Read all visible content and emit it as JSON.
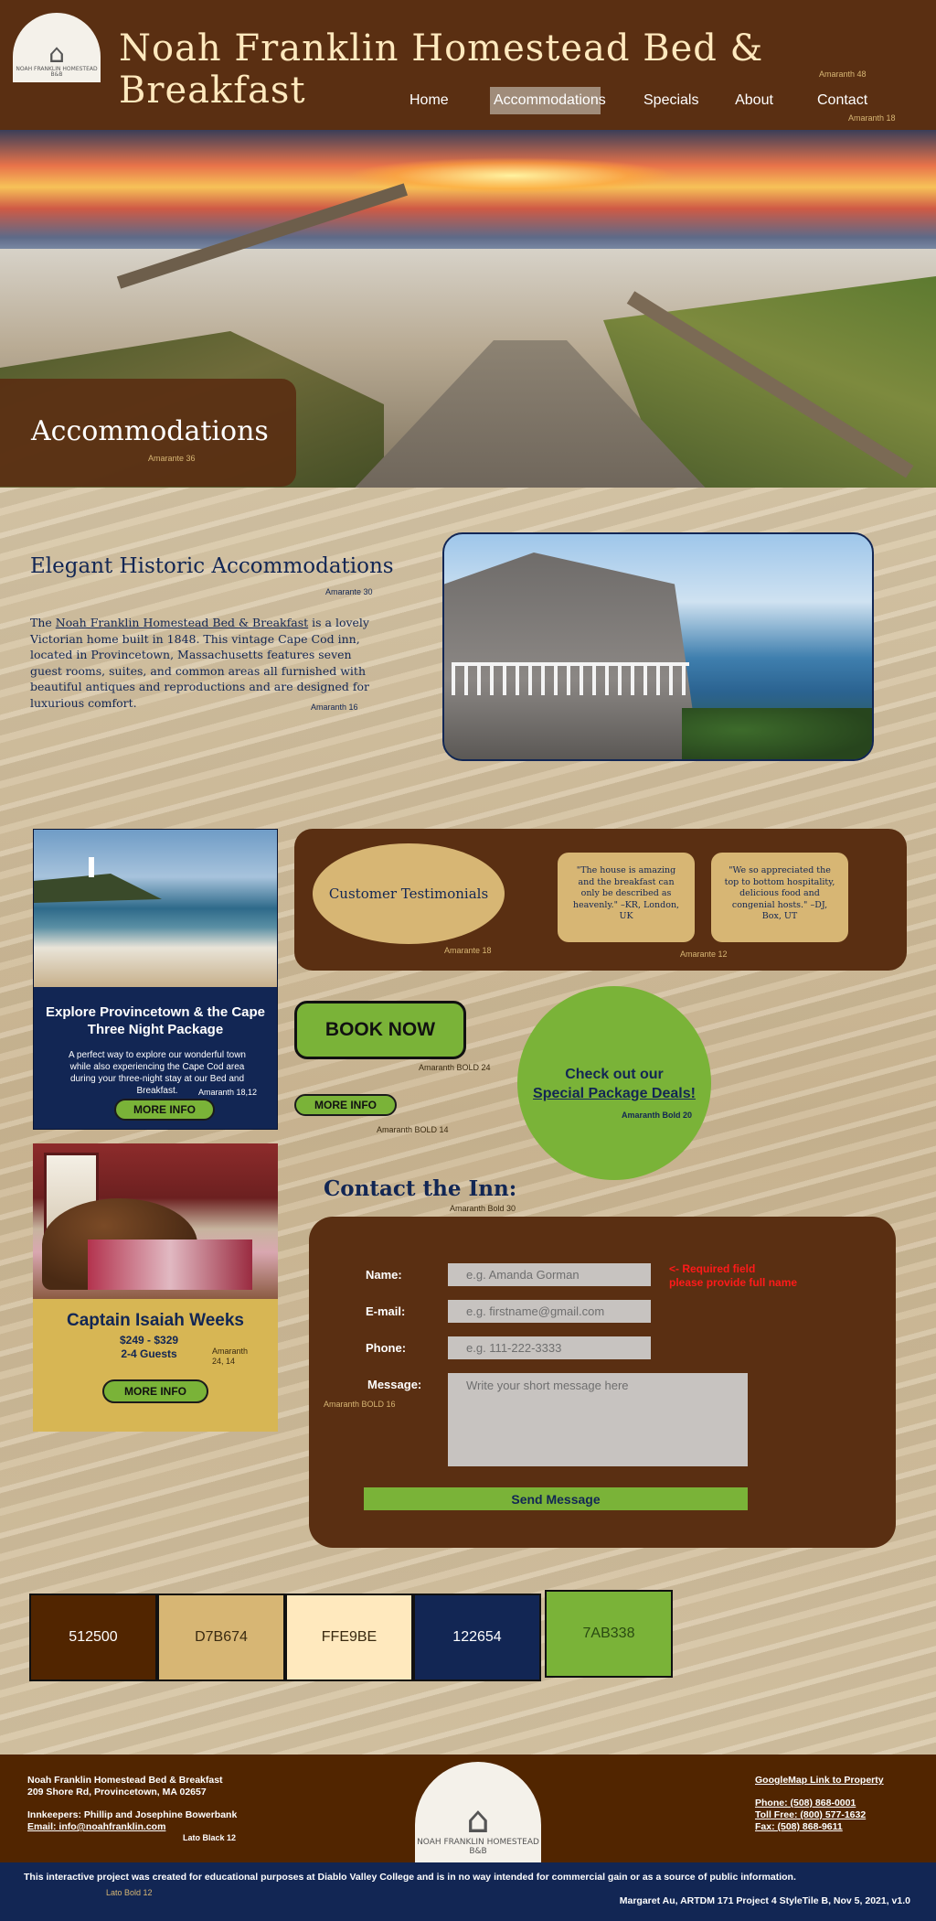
{
  "header": {
    "title": "Noah Franklin Homestead Bed & Breakfast",
    "title_note": "Amaranth 48",
    "nav_note": "Amaranth 18",
    "logo_text": "NOAH FRANKLIN HOMESTEAD B&B",
    "nav": [
      {
        "label": "Home"
      },
      {
        "label": "Accommodations",
        "active": true
      },
      {
        "label": "Specials"
      },
      {
        "label": "About"
      },
      {
        "label": "Contact"
      }
    ]
  },
  "hero": {
    "heading": "Accommodations",
    "note": "Amarante 36"
  },
  "intro": {
    "title": "Elegant Historic Accommodations",
    "title_note": "Amarante 30",
    "text_prefix": "The ",
    "text_link": "Noah Franklin Homestead Bed & Breakfast",
    "text_body": " is a lovely Victorian home built in 1848. This vintage Cape Cod inn, located in Provincetown, Massachusetts features seven guest rooms, suites, and common areas all furnished with beautiful antiques and reproductions and are designed for luxurious comfort.",
    "text_note": "Amaranth 16"
  },
  "package_card": {
    "title": "Explore Provincetown & the Cape Three Night Package",
    "text": "A perfect way to explore our wonderful town while also experiencing the Cape Cod area during your three-night stay at our Bed and Breakfast.",
    "note": "Amaranth 18,12",
    "button": "MORE INFO"
  },
  "room_card": {
    "title": "Captain Isaiah Weeks",
    "price": "$249 - $329",
    "guests": "2-4 Guests",
    "note": "Amaranth 24, 14",
    "button": "MORE INFO"
  },
  "testimonials": {
    "heading": "Customer Testimonials",
    "heading_note": "Amarante  18",
    "quotes_note": "Amarante 12",
    "quotes": [
      "\"The house is amazing and the breakfast can only be described as heavenly.\" –KR, London, UK",
      "\"We so appreciated the top to bottom hospitality, delicious food and congenial hosts.\" –DJ, Box, UT"
    ]
  },
  "book_now": {
    "label": "BOOK NOW",
    "note": "Amaranth BOLD 24"
  },
  "more_info": {
    "label": "MORE INFO",
    "note": "Amaranth BOLD 14"
  },
  "deals": {
    "line1": "Check out our",
    "line2": "Special Package Deals!",
    "note": "Amaranth Bold 20"
  },
  "contact": {
    "title": "Contact the Inn:",
    "title_note": "Amaranth Bold 30",
    "fields_note": "Amaranth  BOLD 16",
    "required_line1": "<- Required field",
    "required_line2": "please provide full name",
    "name_label": "Name:",
    "name_placeholder": "e.g. Amanda Gorman",
    "email_label": "E-mail:",
    "email_placeholder": "e.g. firstname@gmail.com",
    "phone_label": "Phone:",
    "phone_placeholder": "e.g. 111-222-3333",
    "message_label": "Message:",
    "message_placeholder": "Write your short message here",
    "send": "Send Message"
  },
  "swatches": [
    {
      "label": "512500",
      "color": "#512500",
      "text_color": "#ffffff"
    },
    {
      "label": "D7B674",
      "color": "#D7B674",
      "text_color": "#3a2a10"
    },
    {
      "label": "FFE9BE",
      "color": "#FFE9BE",
      "text_color": "#3a2a10"
    },
    {
      "label": "122654",
      "color": "#122654",
      "text_color": "#ffffff"
    },
    {
      "label": "7AB338",
      "color": "#7AB338",
      "text_color": "#2a4a12"
    }
  ],
  "footer": {
    "name": "Noah Franklin Homestead Bed & Breakfast",
    "address": "209 Shore Rd, Provincetown, MA 02657",
    "innkeepers": "Innkeepers: Phillip and Josephine Bowerbank",
    "email": "Email: info@noahfranklin.com",
    "font_note": "Lato Black 12",
    "map_link": "GoogleMap Link to Property",
    "phone": "Phone: (508) 868-0001",
    "toll_free": "Toll Free: (800) 577-1632",
    "fax": "Fax: (508) 868-9611",
    "logo_text": "NOAH FRANKLIN HOMESTEAD B&B",
    "disclaimer": "This interactive project was created for educational purposes at Diablo Valley College and is in no way intended for commercial gain or as a source of public information.",
    "disclaimer_note": "Lato Bold 12",
    "credit": "Margaret Au, ARTDM 171 Project 4 StyleTile B, Nov 5, 2021, v1.0"
  }
}
